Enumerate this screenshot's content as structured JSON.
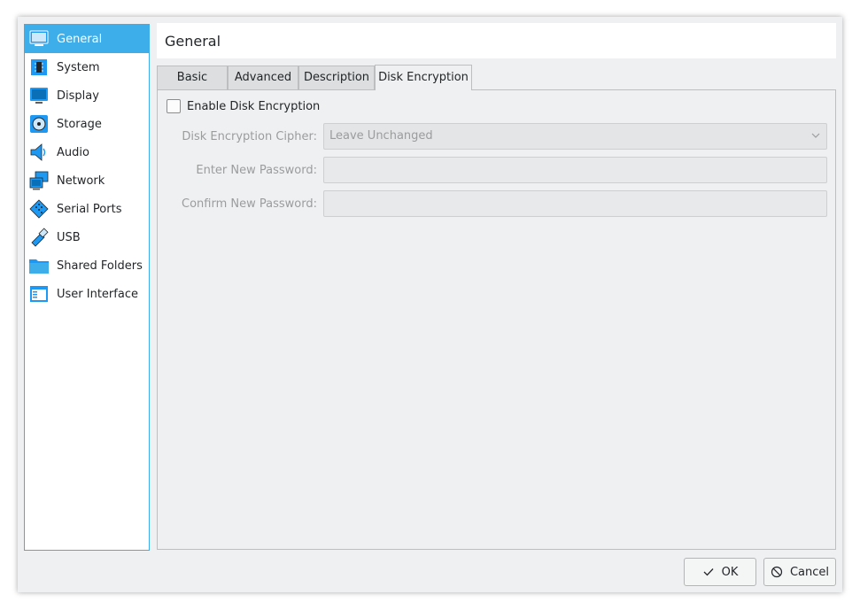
{
  "sidebar": {
    "items": [
      {
        "label": "General",
        "icon": "monitor-icon"
      },
      {
        "label": "System",
        "icon": "chip-icon"
      },
      {
        "label": "Display",
        "icon": "display-icon"
      },
      {
        "label": "Storage",
        "icon": "storage-disc-icon"
      },
      {
        "label": "Audio",
        "icon": "speaker-icon"
      },
      {
        "label": "Network",
        "icon": "network-icon"
      },
      {
        "label": "Serial Ports",
        "icon": "serial-port-icon"
      },
      {
        "label": "USB",
        "icon": "usb-icon"
      },
      {
        "label": "Shared Folders",
        "icon": "folder-icon"
      },
      {
        "label": "User Interface",
        "icon": "user-interface-icon"
      }
    ],
    "active_index": 0
  },
  "header": {
    "title": "General"
  },
  "tabs": [
    {
      "label": "Basic"
    },
    {
      "label": "Advanced"
    },
    {
      "label": "Description"
    },
    {
      "label": "Disk Encryption"
    }
  ],
  "active_tab": 3,
  "disk_encryption": {
    "enable_label": "Enable Disk Encryption",
    "enabled": false,
    "cipher_label": "Disk Encryption Cipher:",
    "cipher_value": "Leave Unchanged",
    "new_password_label": "Enter New Password:",
    "new_password_value": "",
    "confirm_password_label": "Confirm New Password:",
    "confirm_password_value": ""
  },
  "buttons": {
    "ok_label": "OK",
    "cancel_label": "Cancel"
  },
  "colors": {
    "accent": "#3daee9",
    "background": "#eff0f1"
  }
}
